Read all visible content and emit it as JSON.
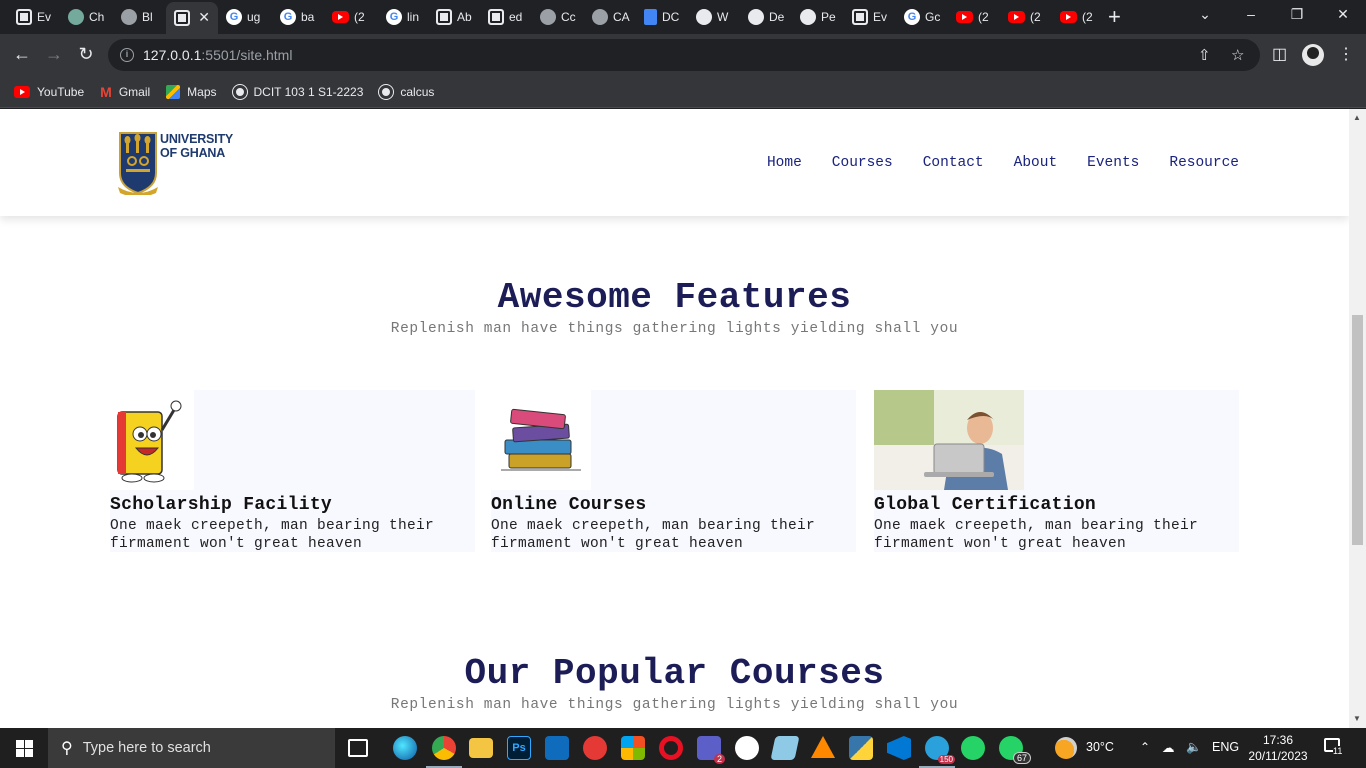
{
  "browser": {
    "tabs": [
      {
        "label": "Ev",
        "icon": "page"
      },
      {
        "label": "Ch",
        "icon": "gpt"
      },
      {
        "label": "Bl",
        "icon": "globe"
      },
      {
        "label": "",
        "icon": "page",
        "active": true
      },
      {
        "label": "ug",
        "icon": "google"
      },
      {
        "label": "ba",
        "icon": "google"
      },
      {
        "label": "(2",
        "icon": "youtube"
      },
      {
        "label": "lin",
        "icon": "google"
      },
      {
        "label": "Ab",
        "icon": "page"
      },
      {
        "label": "ed",
        "icon": "page"
      },
      {
        "label": "Cc",
        "icon": "globe"
      },
      {
        "label": "CA",
        "icon": "globe"
      },
      {
        "label": "DC",
        "icon": "doc"
      },
      {
        "label": "W",
        "icon": "github"
      },
      {
        "label": "De",
        "icon": "github"
      },
      {
        "label": "Pe",
        "icon": "github"
      },
      {
        "label": "Ev",
        "icon": "page"
      },
      {
        "label": "Gc",
        "icon": "google"
      },
      {
        "label": "(2",
        "icon": "youtube"
      },
      {
        "label": "(2",
        "icon": "youtube"
      },
      {
        "label": "(2",
        "icon": "youtube"
      }
    ],
    "new_tab": "+",
    "url_host": "127.0.0.1",
    "url_path": ":5501/site.html",
    "bookmarks": [
      {
        "label": "YouTube",
        "icon": "youtube"
      },
      {
        "label": "Gmail",
        "icon": "gmail"
      },
      {
        "label": "Maps",
        "icon": "maps"
      },
      {
        "label": "DCIT 103 1 S1-2223",
        "icon": "globe"
      },
      {
        "label": "calcus",
        "icon": "globe"
      }
    ]
  },
  "site": {
    "logo_text_line1": "UNIVERSITY",
    "logo_text_line2": "OF GHANA",
    "nav": [
      "Home",
      "Courses",
      "Contact",
      "About",
      "Events",
      "Resource"
    ],
    "features_title": "Awesome Features",
    "features_subtitle": "Replenish man have things gathering lights yielding shall you",
    "features": [
      {
        "title": "Scholarship Facility",
        "text": "One maek creepeth, man bearing their firmament won't great heaven",
        "image": "cartoon-book"
      },
      {
        "title": "Online Courses",
        "text": "One maek creepeth, man bearing their firmament won't great heaven",
        "image": "book-stack"
      },
      {
        "title": "Global Certification",
        "text": "One maek creepeth, man bearing their firmament won't great heaven",
        "image": "man-with-laptop"
      }
    ],
    "courses_title": "Our Popular Courses",
    "courses_subtitle": "Replenish man have things gathering lights yielding shall you"
  },
  "taskbar": {
    "search_placeholder": "Type here to search",
    "weather": "30°C",
    "language": "ENG",
    "time": "17:36",
    "date": "20/11/2023",
    "whatsapp_badge": "67",
    "teams_badge": "2",
    "telegram_badge": "150",
    "notification_count": "11"
  },
  "colors": {
    "heading": "#1c1c57",
    "nav": "#1a237e",
    "card_bg": "#f8f8ff",
    "chrome_dark": "#202124",
    "chrome_toolbar": "#35363a"
  }
}
